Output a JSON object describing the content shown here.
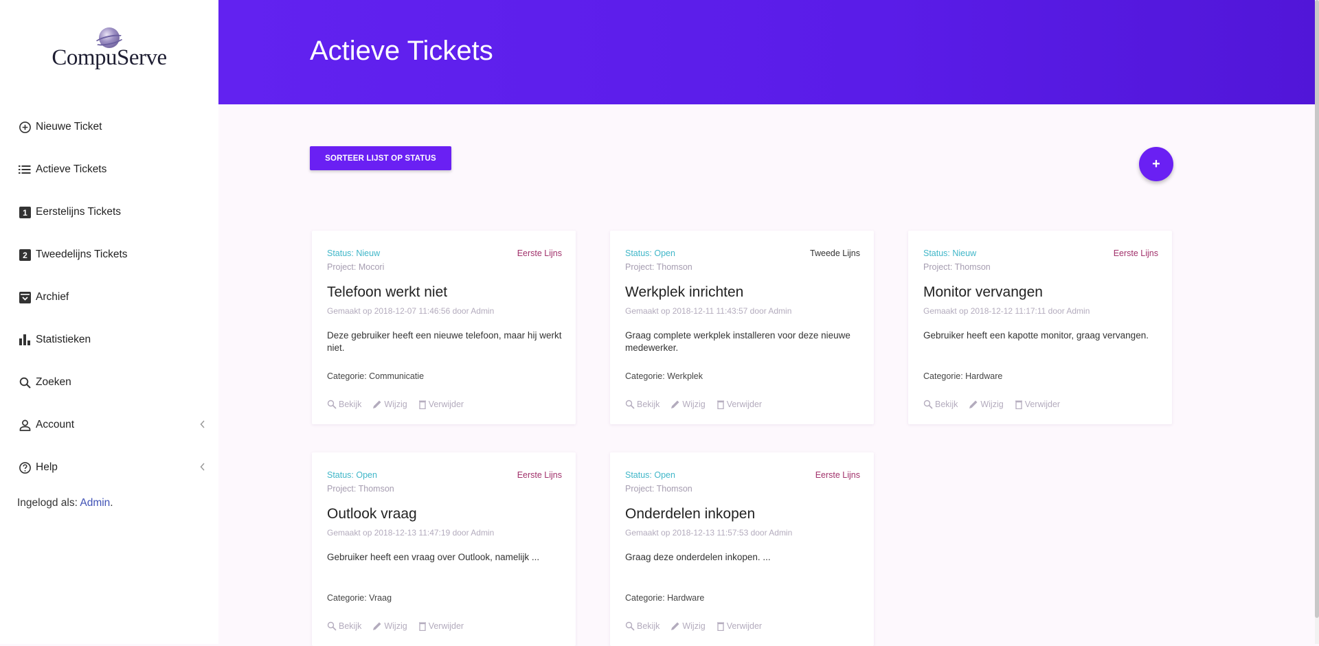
{
  "logo": {
    "text": "CompuServe"
  },
  "nav": {
    "items": [
      {
        "label": "Nieuwe Ticket",
        "icon": "plus-circle-icon"
      },
      {
        "label": "Actieve Tickets",
        "icon": "list-icon"
      },
      {
        "label": "Eerstelijns Tickets",
        "icon": "number-1-box-icon",
        "glyph": "1"
      },
      {
        "label": "Tweedelijns Tickets",
        "icon": "number-2-box-icon",
        "glyph": "2"
      },
      {
        "label": "Archief",
        "icon": "archive-icon"
      },
      {
        "label": "Statistieken",
        "icon": "bar-chart-icon"
      },
      {
        "label": "Zoeken",
        "icon": "search-icon"
      },
      {
        "label": "Account",
        "icon": "user-icon",
        "chevron": "‹"
      },
      {
        "label": "Help",
        "icon": "help-icon",
        "chevron": "‹"
      }
    ],
    "logged_in_prefix": "Ingelogd als: ",
    "logged_in_user": "Admin",
    "logged_in_suffix": "."
  },
  "header": {
    "title": "Actieve Tickets"
  },
  "toolbar": {
    "sort_label": "SORTEER LIJST OP STATUS",
    "add_label": "+"
  },
  "cards": [
    {
      "status": "Status: Nieuw",
      "line": "Eerste Lijns",
      "project": "Project: Mocori",
      "title": "Telefoon werkt niet",
      "meta": "Gemaakt op 2018-12-07 11:46:56 door Admin",
      "description": "Deze gebruiker heeft een nieuwe telefoon, maar hij werkt niet.",
      "category": "Categorie: Communicatie"
    },
    {
      "status": "Status: Open",
      "line": "Tweede Lijns",
      "project": "Project: Thomson",
      "title": "Werkplek inrichten",
      "meta": "Gemaakt op 2018-12-11 11:43:57 door Admin",
      "description": "Graag complete werkplek installeren voor deze nieuwe medewerker.",
      "category": "Categorie: Werkplek"
    },
    {
      "status": "Status: Nieuw",
      "line": "Eerste Lijns",
      "project": "Project: Thomson",
      "title": "Monitor vervangen",
      "meta": "Gemaakt op 2018-12-12 11:17:11 door Admin",
      "description": "Gebruiker heeft een kapotte monitor, graag vervangen.",
      "category": "Categorie: Hardware"
    },
    {
      "status": "Status: Open",
      "line": "Eerste Lijns",
      "project": "Project: Thomson",
      "title": "Outlook vraag",
      "meta": "Gemaakt op 2018-12-13 11:47:19 door Admin",
      "description": "Gebruiker heeft een vraag over Outlook, namelijk ...",
      "category": "Categorie: Vraag"
    },
    {
      "status": "Status: Open",
      "line": "Eerste Lijns",
      "project": "Project: Thomson",
      "title": "Onderdelen inkopen",
      "meta": "Gemaakt op 2018-12-13 11:57:53 door Admin",
      "description": "Graag deze onderdelen inkopen. ...",
      "category": "Categorie: Hardware"
    }
  ],
  "card_actions": {
    "view": "Bekijk",
    "edit": "Wijzig",
    "delete": "Verwijder"
  },
  "colors": {
    "accent": "#6a20f3",
    "header": "#5a1ce8",
    "status": "#3fb6c8",
    "line_first": "#a0306a",
    "line_second": "#333333"
  }
}
